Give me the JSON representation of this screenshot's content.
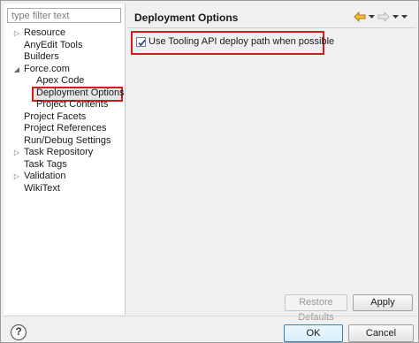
{
  "filter": {
    "placeholder": "type filter text"
  },
  "tree": [
    {
      "label": "Resource",
      "level": 0,
      "twisty": "collapsed"
    },
    {
      "label": "AnyEdit Tools",
      "level": 0,
      "twisty": "none"
    },
    {
      "label": "Builders",
      "level": 0,
      "twisty": "none"
    },
    {
      "label": "Force.com",
      "level": 0,
      "twisty": "expanded"
    },
    {
      "label": "Apex Code",
      "level": 1,
      "twisty": "none"
    },
    {
      "label": "Deployment Options",
      "level": 1,
      "twisty": "none",
      "selected": true
    },
    {
      "label": "Project Contents",
      "level": 1,
      "twisty": "none"
    },
    {
      "label": "Project Facets",
      "level": 0,
      "twisty": "none"
    },
    {
      "label": "Project References",
      "level": 0,
      "twisty": "none"
    },
    {
      "label": "Run/Debug Settings",
      "level": 0,
      "twisty": "none"
    },
    {
      "label": "Task Repository",
      "level": 0,
      "twisty": "collapsed"
    },
    {
      "label": "Task Tags",
      "level": 0,
      "twisty": "none"
    },
    {
      "label": "Validation",
      "level": 0,
      "twisty": "collapsed"
    },
    {
      "label": "WikiText",
      "level": 0,
      "twisty": "none"
    }
  ],
  "page": {
    "title": "Deployment Options",
    "option": {
      "label": "Use Tooling API deploy path when possible",
      "checked": true
    }
  },
  "nav": {
    "back_icon": "back-arrow-icon",
    "forward_icon": "forward-arrow-icon",
    "color_active": "#e0a020",
    "color_inactive": "#b8b8b8"
  },
  "buttons": {
    "restore_defaults": "Restore Defaults",
    "apply": "Apply",
    "ok": "OK",
    "cancel": "Cancel"
  },
  "help": {
    "label": "?"
  },
  "colors": {
    "highlight": "#cc2020"
  }
}
